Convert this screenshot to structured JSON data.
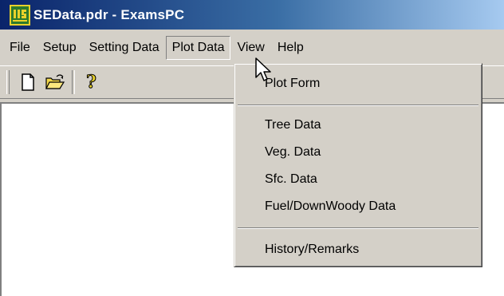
{
  "window": {
    "title": "SEData.pdr - ExamsPC",
    "app_icon": "usfs-shield-icon"
  },
  "menubar": {
    "items": [
      {
        "label": "File"
      },
      {
        "label": "Setup"
      },
      {
        "label": "Setting Data"
      },
      {
        "label": "Plot Data",
        "active": true
      },
      {
        "label": "View"
      },
      {
        "label": "Help"
      }
    ]
  },
  "toolbar": {
    "buttons": [
      {
        "icon": "new-document-icon"
      },
      {
        "icon": "open-folder-icon"
      },
      {
        "icon": "help-question-icon"
      }
    ]
  },
  "plot_data_menu": {
    "items": [
      {
        "label": "Plot Form"
      },
      {
        "label": "Tree Data"
      },
      {
        "label": "Veg. Data"
      },
      {
        "label": "Sfc. Data"
      },
      {
        "label": "Fuel/DownWoody Data"
      },
      {
        "label": "History/Remarks"
      }
    ]
  },
  "colors": {
    "title_bar_start": "#0a246a",
    "title_bar_end": "#a6caf0",
    "face": "#d4d0c8",
    "client": "#ffffff"
  }
}
